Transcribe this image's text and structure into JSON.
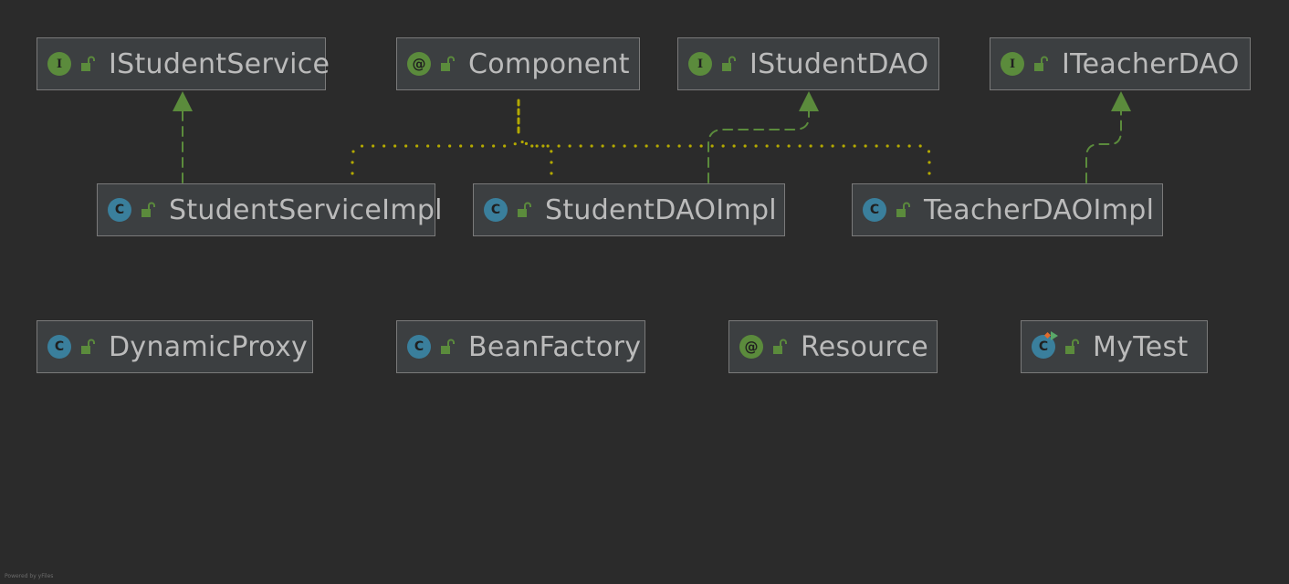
{
  "diagram": {
    "nodes": [
      {
        "id": "IStudentService",
        "kind": "interface",
        "label": "IStudentService"
      },
      {
        "id": "Component",
        "kind": "annotation",
        "label": "Component"
      },
      {
        "id": "IStudentDAO",
        "kind": "interface",
        "label": "IStudentDAO"
      },
      {
        "id": "ITeacherDAO",
        "kind": "interface",
        "label": "ITeacherDAO"
      },
      {
        "id": "StudentServiceImpl",
        "kind": "class",
        "label": "StudentServiceImpl"
      },
      {
        "id": "StudentDAOImpl",
        "kind": "class",
        "label": "StudentDAOImpl"
      },
      {
        "id": "TeacherDAOImpl",
        "kind": "class",
        "label": "TeacherDAOImpl"
      },
      {
        "id": "DynamicProxy",
        "kind": "class",
        "label": "DynamicProxy"
      },
      {
        "id": "BeanFactory",
        "kind": "class",
        "label": "BeanFactory"
      },
      {
        "id": "Resource",
        "kind": "annotation",
        "label": "Resource"
      },
      {
        "id": "MyTest",
        "kind": "test-class",
        "label": "MyTest"
      }
    ],
    "edges": [
      {
        "from": "StudentServiceImpl",
        "to": "IStudentService",
        "type": "implements"
      },
      {
        "from": "StudentDAOImpl",
        "to": "IStudentDAO",
        "type": "implements"
      },
      {
        "from": "TeacherDAOImpl",
        "to": "ITeacherDAO",
        "type": "implements"
      },
      {
        "from": "StudentServiceImpl",
        "to": "Component",
        "type": "annotated-with"
      },
      {
        "from": "StudentDAOImpl",
        "to": "Component",
        "type": "annotated-with"
      },
      {
        "from": "TeacherDAOImpl",
        "to": "Component",
        "type": "annotated-with"
      }
    ],
    "badge_glyphs": {
      "interface": "I",
      "class": "C",
      "annotation": "@",
      "test-class": "C"
    },
    "icons": {
      "visibility": "unlocked-padlock-icon"
    },
    "colors": {
      "background": "#2b2b2b",
      "node_fill": "#3c3f41",
      "node_border": "#7a7a7a",
      "text": "#bbbbbb",
      "interface_badge": "#5b8b3c",
      "class_badge": "#3a7f9c",
      "implements_edge": "#5b8b3c",
      "annotation_edge": "#b3a900"
    }
  },
  "footer": {
    "text": "Powered by yFiles"
  }
}
